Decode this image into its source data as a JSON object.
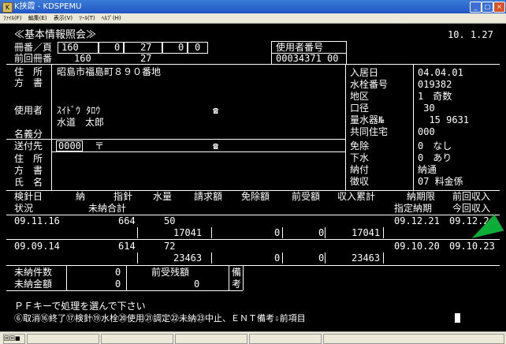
{
  "window": {
    "title": "K挟霞 - KDSPEMU",
    "icon_label": "K"
  },
  "menu": [
    "ﾌｧｲﾙ(F)",
    "編集(E)",
    "表示(V)",
    "ﾂｰﾙ(T)",
    "ﾍﾙﾌﾟ(H)"
  ],
  "header": {
    "title": "≪基本情報照会≫",
    "date": "10. 1.27",
    "book_label": "冊番／頁",
    "book_values": [
      "160",
      "0",
      "27",
      "0",
      "0"
    ],
    "user_no_label": "使用者番号",
    "user_no": "00034371 00",
    "prev_label": "前回冊番",
    "prev_book": "160",
    "prev_page": "27"
  },
  "address": {
    "label1": "住　所",
    "label2": "方　書",
    "value": "昭島市福島町８９０番地"
  },
  "user": {
    "label": "使用者",
    "kana": "ｽｲﾄﾞｳ ﾀﾛｳ",
    "name": "水道　太郎",
    "tel_icon": "☎",
    "name_kubun_label": "名義分"
  },
  "sendto": {
    "label": "送付先",
    "code": "0000",
    "postal_icon": "〒",
    "tel_icon": "☎",
    "addr_label": "住　所",
    "dir_label": "方　書",
    "name_label": "氏　名"
  },
  "info": [
    {
      "label": "入居日",
      "value": "04.04.01"
    },
    {
      "label": "水栓番号",
      "value": "019382"
    },
    {
      "label": "地区",
      "value": "1　奇数"
    },
    {
      "label": "口径",
      "value": " 30"
    },
    {
      "label": "量水器№",
      "value": "  15 9631"
    },
    {
      "label": "共同住宅",
      "value": "000"
    },
    {
      "label": "免除",
      "value": "0　なし"
    },
    {
      "label": "下水",
      "value": "0　あり"
    },
    {
      "label": "納付",
      "value": "納通"
    },
    {
      "label": "徴収",
      "value": "07 料金係"
    }
  ],
  "table": {
    "headers1": [
      "検針日",
      "納",
      "指針",
      "水量",
      "請求額",
      "免除額",
      "前受額",
      "収入累計",
      "納期限",
      "前回収入"
    ],
    "headers2": [
      "状況",
      "未納合計",
      "指定納期",
      "今回収入"
    ],
    "rows": [
      {
        "date": "09.11.16",
        "reading": "664",
        "volume": "50",
        "amount": "17041",
        "exempt": "0",
        "prepaid": "0",
        "cumulative": "17041",
        "due": "09.12.21",
        "prev_income": "09.12.2"
      },
      {
        "date": "09.09.14",
        "reading": "614",
        "volume": "72",
        "amount": "23463",
        "exempt": "0",
        "prepaid": "0",
        "cumulative": "23463",
        "due": "09.10.20",
        "prev_income": "09.10.23"
      }
    ]
  },
  "summary": {
    "unpaid_count_label": "未納件数",
    "unpaid_count": "0",
    "unpaid_amount_label": "未納金額",
    "unpaid_amount": "0",
    "prepaid_balance_label": "前受残額",
    "prepaid_balance": "0",
    "note_label1": "備",
    "note_label2": "考"
  },
  "footer": {
    "prompt": "ＰＦキーで処理を選んで下さい",
    "keys": "⑥取消⑯終了⑰検針⑲水栓⑳使用㉑調定㉒未納㉓中止、ＥＮＴ備考⇩前項目"
  },
  "statusbar": {
    "left": "回回■"
  }
}
